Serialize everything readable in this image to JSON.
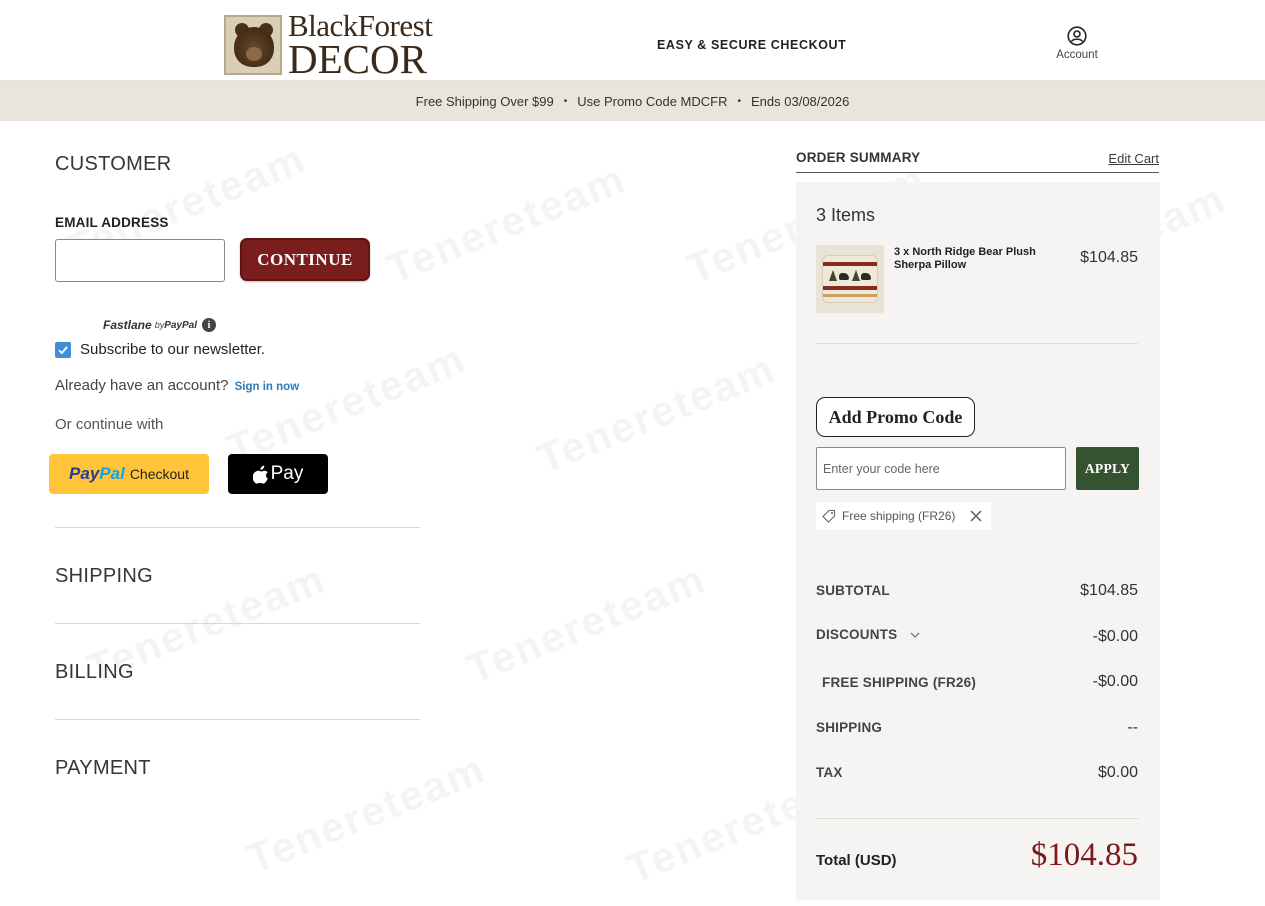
{
  "header": {
    "logo_line1": "BlackForest",
    "logo_line2": "DECOR",
    "checkout_title": "EASY & SECURE CHECKOUT",
    "account_label": "Account",
    "account_icon": "user-circle-icon"
  },
  "promo_bar": {
    "items": [
      "Free Shipping Over $99",
      "Use Promo Code MDCFR",
      "Ends 03/08/2026"
    ],
    "separator": "•"
  },
  "customer": {
    "title": "CUSTOMER",
    "email_label": "EMAIL ADDRESS",
    "email_value": "",
    "continue_label": "CONTINUE",
    "fastlane_label": "Fastlane",
    "fastlane_by": "by",
    "fastlane_paypal": "PayPal",
    "fastlane_info": "i",
    "newsletter_label": "Subscribe to our newsletter.",
    "newsletter_checked": true,
    "have_account_text": "Already have an account?",
    "sign_in_label": "Sign in now",
    "or_continue_text": "Or continue with",
    "paypal_pay": "Pay",
    "paypal_pal": "Pal",
    "paypal_checkout": "Checkout",
    "apple_pay_label": "Pay"
  },
  "sections": {
    "shipping": "SHIPPING",
    "billing": "BILLING",
    "payment": "PAYMENT"
  },
  "summary": {
    "title": "ORDER SUMMARY",
    "edit_cart": "Edit Cart",
    "items_count": "3 Items",
    "item": {
      "name": "3 x North Ridge Bear Plush Sherpa Pillow",
      "price": "$104.85"
    },
    "add_promo_label": "Add Promo Code",
    "promo_placeholder": "Enter your code here",
    "apply_label": "APPLY",
    "applied_coupon": "Free shipping (FR26)",
    "rows": {
      "subtotal_label": "SUBTOTAL",
      "subtotal_value": "$104.85",
      "discounts_label": "DISCOUNTS",
      "discounts_value": "-$0.00",
      "free_shipping_label": "FREE SHIPPING (FR26)",
      "free_shipping_value": "-$0.00",
      "shipping_label": "SHIPPING",
      "shipping_value": "--",
      "tax_label": "TAX",
      "tax_value": "$0.00",
      "total_label": "Total (USD)",
      "total_value": "$104.85"
    }
  },
  "colors": {
    "brand_maroon": "#7a1d1d",
    "apply_green": "#355330",
    "promo_bar_bg": "#e7e5dc",
    "paypal_yellow": "#ffc43a",
    "summary_bg": "#f5f4f2"
  },
  "watermark": "Tenereteam"
}
